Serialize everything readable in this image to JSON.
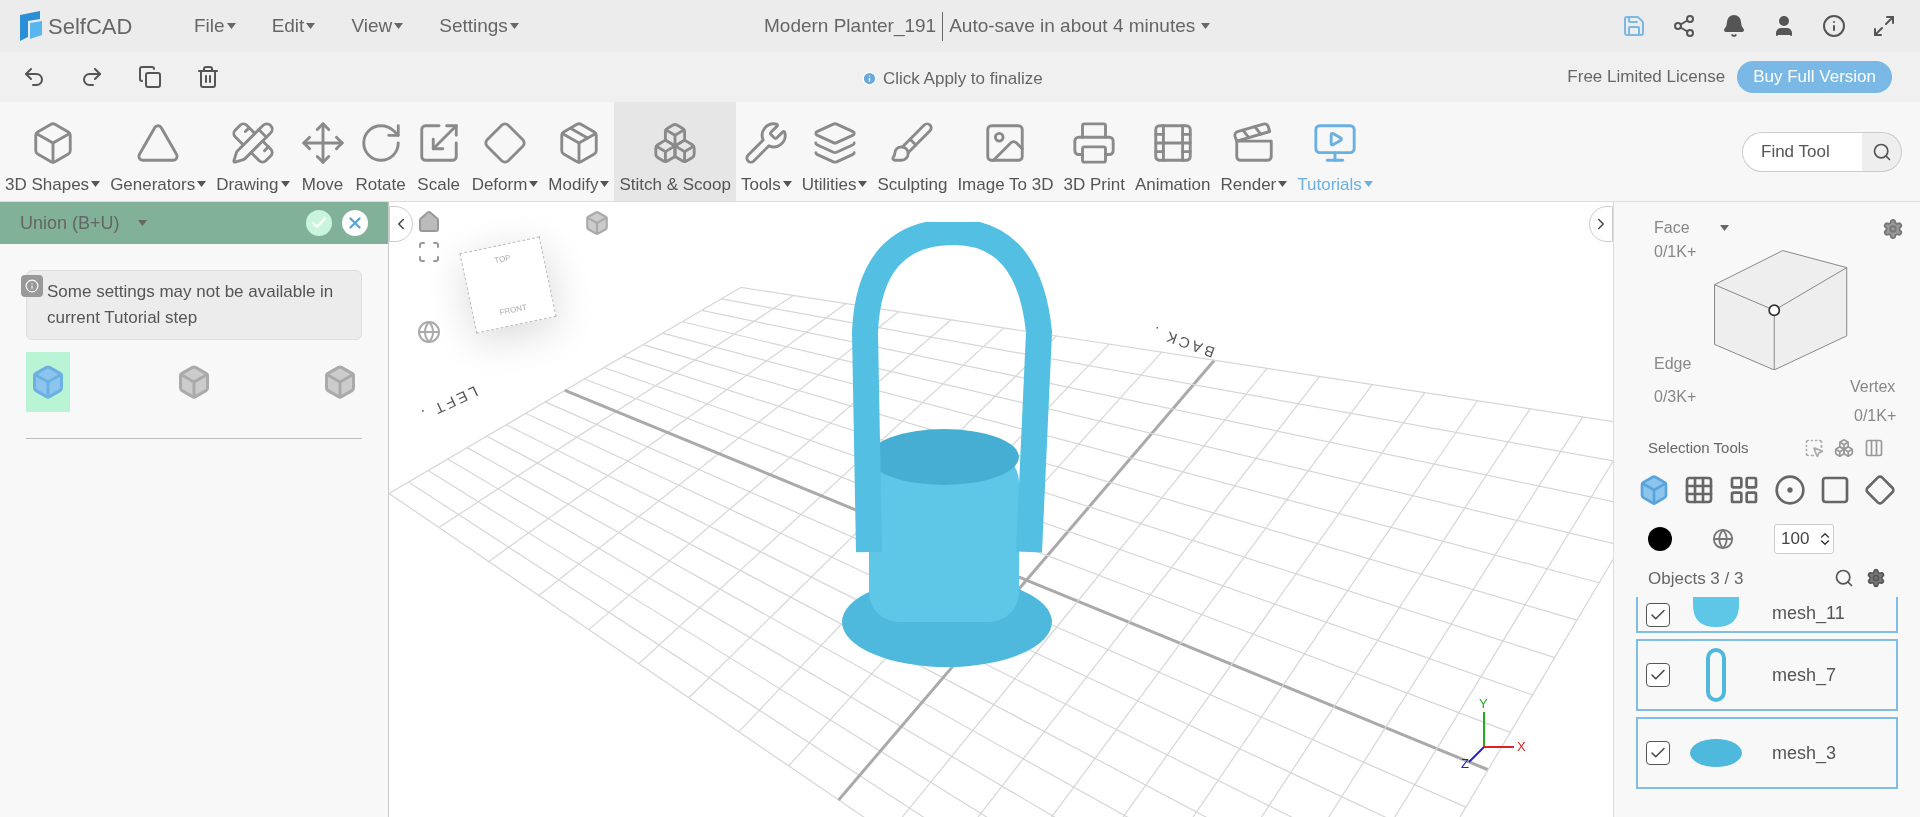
{
  "logo": {
    "text": "SelfCAD"
  },
  "menu": [
    {
      "label": "File"
    },
    {
      "label": "Edit"
    },
    {
      "label": "View"
    },
    {
      "label": "Settings"
    }
  ],
  "document": {
    "title": "Modern Planter_191",
    "autosave": "Auto-save in about 4 minutes"
  },
  "hint": "Click Apply to finalize",
  "license": "Free Limited License",
  "buy_button": "Buy Full Version",
  "tools": [
    {
      "label": "3D Shapes",
      "dropdown": true,
      "selected": false,
      "accent": false
    },
    {
      "label": "Generators",
      "dropdown": true,
      "selected": false,
      "accent": false
    },
    {
      "label": "Drawing",
      "dropdown": true,
      "selected": false,
      "accent": false
    },
    {
      "label": "Move",
      "dropdown": false,
      "selected": false,
      "accent": false
    },
    {
      "label": "Rotate",
      "dropdown": false,
      "selected": false,
      "accent": false
    },
    {
      "label": "Scale",
      "dropdown": false,
      "selected": false,
      "accent": false
    },
    {
      "label": "Deform",
      "dropdown": true,
      "selected": false,
      "accent": false
    },
    {
      "label": "Modify",
      "dropdown": true,
      "selected": false,
      "accent": false
    },
    {
      "label": "Stitch & Scoop",
      "dropdown": false,
      "selected": true,
      "accent": false
    },
    {
      "label": "Tools",
      "dropdown": true,
      "selected": false,
      "accent": false
    },
    {
      "label": "Utilities",
      "dropdown": true,
      "selected": false,
      "accent": false
    },
    {
      "label": "Sculpting",
      "dropdown": false,
      "selected": false,
      "accent": false
    },
    {
      "label": "Image To 3D",
      "dropdown": false,
      "selected": false,
      "accent": false
    },
    {
      "label": "3D Print",
      "dropdown": false,
      "selected": false,
      "accent": false
    },
    {
      "label": "Animation",
      "dropdown": false,
      "selected": false,
      "accent": false
    },
    {
      "label": "Render",
      "dropdown": true,
      "selected": false,
      "accent": false
    },
    {
      "label": "Tutorials",
      "dropdown": true,
      "selected": false,
      "accent": true
    }
  ],
  "find_tool": {
    "placeholder": "Find Tool"
  },
  "operation_panel": {
    "title": "Union (B+U)",
    "notice": "Some settings may not be available in current Tutorial step",
    "modes": [
      {
        "selected": true
      },
      {
        "selected": false
      },
      {
        "selected": false
      }
    ]
  },
  "viewport": {
    "cube_labels": [
      "TOP",
      "FRONT"
    ],
    "ground_labels": [
      "LEFT .",
      "BACK ."
    ],
    "axes": [
      "Y",
      "X",
      "Z"
    ]
  },
  "selection": {
    "face": {
      "label": "Face",
      "count": "0/1K+"
    },
    "edge": {
      "label": "Edge",
      "count": "0/3K+"
    },
    "vertex": {
      "label": "Vertex",
      "count": "0/1K+"
    },
    "tools_label": "Selection Tools",
    "tools": [
      {
        "selected": true
      },
      {
        "selected": false
      },
      {
        "selected": false
      },
      {
        "selected": false
      },
      {
        "selected": false
      },
      {
        "selected": false
      }
    ],
    "opacity": "100"
  },
  "objects": {
    "title": "Objects 3 / 3",
    "items": [
      {
        "name": "mesh_11",
        "checked": true,
        "kind": "cup"
      },
      {
        "name": "mesh_7",
        "checked": true,
        "kind": "handle"
      },
      {
        "name": "mesh_3",
        "checked": true,
        "kind": "disc"
      }
    ]
  }
}
